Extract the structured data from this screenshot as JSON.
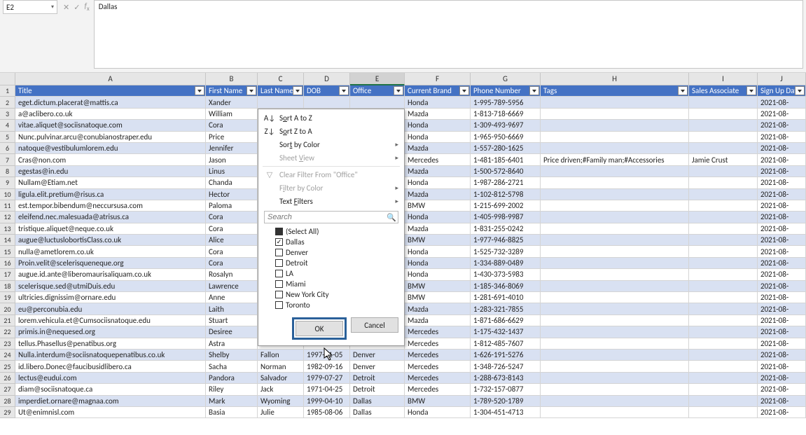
{
  "formula_bar": {
    "name_box": "E2",
    "value": "Dallas"
  },
  "columns": [
    "A",
    "B",
    "C",
    "D",
    "E",
    "F",
    "G",
    "H",
    "I",
    "J"
  ],
  "headers": {
    "A": "Title",
    "B": "First Name",
    "C": "Last Name",
    "D": "DOB",
    "E": "Office",
    "F": "Current Brand",
    "G": "Phone Number",
    "H": "Tags",
    "I": "Sales Associate",
    "J": "Sign Up Date"
  },
  "selected_column": "E",
  "filter_popup": {
    "sort_az": "Sort A to Z",
    "sort_za": "Sort Z to A",
    "sort_color": "Sort by Color",
    "sheet_view": "Sheet View",
    "clear": "Clear Filter From \"Office\"",
    "filter_color": "Filter by Color",
    "text_filters": "Text Filters",
    "search_placeholder": "Search",
    "options": [
      {
        "label": "(Select All)",
        "checked": false,
        "all": true
      },
      {
        "label": "Dallas",
        "checked": true
      },
      {
        "label": "Denver",
        "checked": false
      },
      {
        "label": "Detroit",
        "checked": false
      },
      {
        "label": "LA",
        "checked": false
      },
      {
        "label": "Miami",
        "checked": false
      },
      {
        "label": "New York City",
        "checked": false
      },
      {
        "label": "Toronto",
        "checked": false
      }
    ],
    "ok": "OK",
    "cancel": "Cancel"
  },
  "rows": [
    {
      "n": 2,
      "A": "eget.dictum.placerat@mattis.ca",
      "B": "Xander",
      "C": "",
      "D": "",
      "E": "",
      "F": "Honda",
      "G": "1-995-789-5956",
      "H": "",
      "I": "",
      "J": "2021-08-"
    },
    {
      "n": 3,
      "A": "a@aclibero.co.uk",
      "B": "William",
      "C": "",
      "D": "",
      "E": "",
      "F": "Mazda",
      "G": "1-813-718-6669",
      "H": "",
      "I": "",
      "J": "2021-08-"
    },
    {
      "n": 4,
      "A": "vitae.aliquet@sociisnatoque.com",
      "B": "Cora",
      "C": "",
      "D": "",
      "E": "",
      "F": "Honda",
      "G": "1-309-493-9697",
      "H": "",
      "I": "",
      "J": "2021-08-"
    },
    {
      "n": 5,
      "A": "Nunc.pulvinar.arcu@conubianostraper.edu",
      "B": "Price",
      "C": "",
      "D": "",
      "E": "",
      "F": "Honda",
      "G": "1-965-950-6669",
      "H": "",
      "I": "",
      "J": "2021-08-"
    },
    {
      "n": 6,
      "A": "natoque@vestibulumlorem.edu",
      "B": "Jennifer",
      "C": "",
      "D": "",
      "E": "",
      "F": "Mazda",
      "G": "1-557-280-1625",
      "H": "",
      "I": "",
      "J": "2021-08-"
    },
    {
      "n": 7,
      "A": "Cras@non.com",
      "B": "Jason",
      "C": "",
      "D": "",
      "E": "",
      "F": "Mercedes",
      "G": "1-481-185-6401",
      "H": "Price driven;#Family man;#Accessories",
      "I": "Jamie Crust",
      "J": "2021-08-"
    },
    {
      "n": 8,
      "A": "egestas@in.edu",
      "B": "Linus",
      "C": "",
      "D": "",
      "E": "",
      "F": "Mazda",
      "G": "1-500-572-8640",
      "H": "",
      "I": "",
      "J": "2021-08-"
    },
    {
      "n": 9,
      "A": "Nullam@Etiam.net",
      "B": "Chanda",
      "C": "",
      "D": "",
      "E": "",
      "F": "Honda",
      "G": "1-987-286-2721",
      "H": "",
      "I": "",
      "J": "2021-08-"
    },
    {
      "n": 10,
      "A": "ligula.elit.pretium@risus.ca",
      "B": "Hector",
      "C": "",
      "D": "",
      "E": "",
      "F": "Mazda",
      "G": "1-102-812-5798",
      "H": "",
      "I": "",
      "J": "2021-08-"
    },
    {
      "n": 11,
      "A": "est.tempor.bibendum@neccursusa.com",
      "B": "Paloma",
      "C": "",
      "D": "",
      "E": "",
      "F": "BMW",
      "G": "1-215-699-2002",
      "H": "",
      "I": "",
      "J": "2021-08-"
    },
    {
      "n": 12,
      "A": "eleifend.nec.malesuada@atrisus.ca",
      "B": "Cora",
      "C": "",
      "D": "",
      "E": "",
      "F": "Honda",
      "G": "1-405-998-9987",
      "H": "",
      "I": "",
      "J": "2021-08-"
    },
    {
      "n": 13,
      "A": "tristique.aliquet@neque.co.uk",
      "B": "Cora",
      "C": "",
      "D": "",
      "E": "",
      "F": "Mazda",
      "G": "1-831-255-0242",
      "H": "",
      "I": "",
      "J": "2021-08-"
    },
    {
      "n": 14,
      "A": "augue@luctuslobortisClass.co.uk",
      "B": "Alice",
      "C": "",
      "D": "",
      "E": "",
      "F": "BMW",
      "G": "1-977-946-8825",
      "H": "",
      "I": "",
      "J": "2021-08-"
    },
    {
      "n": 15,
      "A": "nulla@ametlorem.co.uk",
      "B": "Cora",
      "C": "",
      "D": "",
      "E": "",
      "F": "Honda",
      "G": "1-525-732-3289",
      "H": "",
      "I": "",
      "J": "2021-08-"
    },
    {
      "n": 16,
      "A": "Proin.velit@scelerisqueneque.org",
      "B": "Cora",
      "C": "",
      "D": "",
      "E": "",
      "F": "Honda",
      "G": "1-334-889-0489",
      "H": "",
      "I": "",
      "J": "2021-08-"
    },
    {
      "n": 17,
      "A": "augue.id.ante@liberomaurisaliquam.co.uk",
      "B": "Rosalyn",
      "C": "",
      "D": "",
      "E": "",
      "F": "Honda",
      "G": "1-430-373-5983",
      "H": "",
      "I": "",
      "J": "2021-08-"
    },
    {
      "n": 18,
      "A": "scelerisque.sed@utmiDuis.edu",
      "B": "Lawrence",
      "C": "",
      "D": "",
      "E": "",
      "F": "BMW",
      "G": "1-185-346-8069",
      "H": "",
      "I": "",
      "J": "2021-08-"
    },
    {
      "n": 19,
      "A": "ultricies.dignissim@ornare.edu",
      "B": "Anne",
      "C": "",
      "D": "",
      "E": "",
      "F": "BMW",
      "G": "1-281-691-4010",
      "H": "",
      "I": "",
      "J": "2021-08-"
    },
    {
      "n": 20,
      "A": "eu@perconubia.edu",
      "B": "Laith",
      "C": "",
      "D": "",
      "E": "",
      "F": "Mazda",
      "G": "1-283-321-7855",
      "H": "",
      "I": "",
      "J": "2021-08-"
    },
    {
      "n": 21,
      "A": "lorem.vehicula.et@Cumsociisnatoque.edu",
      "B": "Stuart",
      "C": "",
      "D": "",
      "E": "",
      "F": "Mazda",
      "G": "1-871-686-6629",
      "H": "",
      "I": "",
      "J": "2021-08-"
    },
    {
      "n": 22,
      "A": "primis.in@nequesed.org",
      "B": "Desiree",
      "C": "",
      "D": "",
      "E": "",
      "F": "Mercedes",
      "G": "1-175-432-1437",
      "H": "",
      "I": "",
      "J": "2021-08-"
    },
    {
      "n": 23,
      "A": "tellus.Phasellus@penatibus.org",
      "B": "Astra",
      "C": "",
      "D": "",
      "E": "",
      "F": "Mercedes",
      "G": "1-812-485-7607",
      "H": "",
      "I": "",
      "J": "2021-08-"
    },
    {
      "n": 24,
      "A": "Nulla.interdum@sociisnatoquepenatibus.co.uk",
      "B": "Shelby",
      "C": "Fallon",
      "D": "1997-11-05",
      "E": "Denver",
      "F": "Mercedes",
      "G": "1-626-191-5276",
      "H": "",
      "I": "",
      "J": "2021-08-"
    },
    {
      "n": 25,
      "A": "id.libero.Donec@faucibusidlibero.ca",
      "B": "Sacha",
      "C": "Norman",
      "D": "1982-09-16",
      "E": "Denver",
      "F": "Mercedes",
      "G": "1-348-726-5247",
      "H": "",
      "I": "",
      "J": "2021-08-"
    },
    {
      "n": 26,
      "A": "lectus@eudui.com",
      "B": "Pandora",
      "C": "Salvador",
      "D": "1979-07-27",
      "E": "Detroit",
      "F": "Mercedes",
      "G": "1-288-673-8143",
      "H": "",
      "I": "",
      "J": "2021-08-"
    },
    {
      "n": 27,
      "A": "diam@sociisnatoque.ca",
      "B": "Riley",
      "C": "Jack",
      "D": "1971-04-25",
      "E": "Detroit",
      "F": "Mercedes",
      "G": "1-732-157-0877",
      "H": "",
      "I": "",
      "J": "2021-08-"
    },
    {
      "n": 28,
      "A": "imperdiet.ornare@magnaa.com",
      "B": "Mark",
      "C": "Wyoming",
      "D": "1999-04-10",
      "E": "Dallas",
      "F": "BMW",
      "G": "1-789-520-1789",
      "H": "",
      "I": "",
      "J": "2021-08-"
    },
    {
      "n": 29,
      "A": "Ut@enimnisl.com",
      "B": "Basia",
      "C": "Julie",
      "D": "1985-08-06",
      "E": "Dallas",
      "F": "Honda",
      "G": "1-304-451-4713",
      "H": "",
      "I": "",
      "J": "2021-08-"
    }
  ]
}
